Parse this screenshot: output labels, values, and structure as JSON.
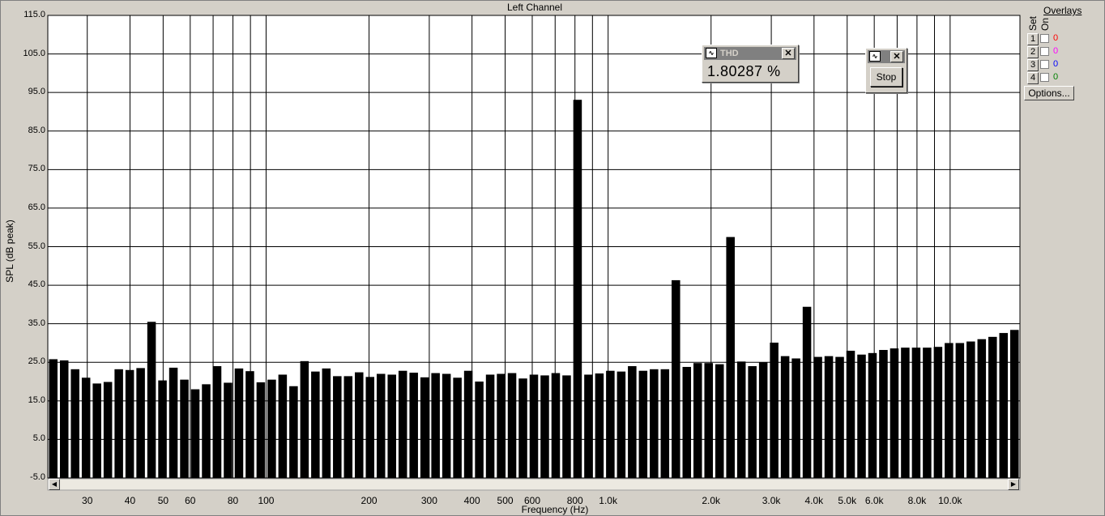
{
  "chart_data": {
    "type": "bar",
    "title": "Left Channel",
    "xlabel": "Frequency (Hz)",
    "ylabel": "SPL (dB peak)",
    "x_scale": "log",
    "xlim": [
      23,
      16000
    ],
    "ylim": [
      -5,
      115
    ],
    "grid": true,
    "y_ticks": [
      "115.0",
      "105.0",
      "95.0",
      "85.0",
      "75.0",
      "65.0",
      "55.0",
      "45.0",
      "35.0",
      "25.0",
      "15.0",
      "5.0",
      "-5.0"
    ],
    "y_tick_values": [
      115,
      105,
      95,
      85,
      75,
      65,
      55,
      45,
      35,
      25,
      15,
      5,
      -5
    ],
    "x_ticks": [
      {
        "value": 30,
        "label": "30"
      },
      {
        "value": 40,
        "label": "40"
      },
      {
        "value": 50,
        "label": "50"
      },
      {
        "value": 60,
        "label": "60"
      },
      {
        "value": 80,
        "label": "80"
      },
      {
        "value": 100,
        "label": "100"
      },
      {
        "value": 200,
        "label": "200"
      },
      {
        "value": 300,
        "label": "300"
      },
      {
        "value": 400,
        "label": "400"
      },
      {
        "value": 500,
        "label": "500"
      },
      {
        "value": 600,
        "label": "600"
      },
      {
        "value": 800,
        "label": "800"
      },
      {
        "value": 1000,
        "label": "1.0k"
      },
      {
        "value": 2000,
        "label": "2.0k"
      },
      {
        "value": 3000,
        "label": "3.0k"
      },
      {
        "value": 4000,
        "label": "4.0k"
      },
      {
        "value": 5000,
        "label": "5.0k"
      },
      {
        "value": 6000,
        "label": "6.0k"
      },
      {
        "value": 8000,
        "label": "8.0k"
      },
      {
        "value": 10000,
        "label": "10.0k"
      }
    ],
    "x_grid_values": [
      30,
      40,
      50,
      60,
      70,
      80,
      90,
      100,
      200,
      300,
      400,
      500,
      600,
      700,
      800,
      900,
      1000,
      2000,
      3000,
      4000,
      5000,
      6000,
      7000,
      8000,
      9000,
      10000
    ],
    "bar_fraction": 0.78,
    "values": [
      25.8,
      25.5,
      23.2,
      21.0,
      19.5,
      19.9,
      23.2,
      23.0,
      23.5,
      35.5,
      20.3,
      23.6,
      20.5,
      18.0,
      19.3,
      24.0,
      19.7,
      23.4,
      22.7,
      19.8,
      20.5,
      21.8,
      18.8,
      25.3,
      22.6,
      23.4,
      21.4,
      21.4,
      22.4,
      21.2,
      22.0,
      21.8,
      22.8,
      22.3,
      21.1,
      22.2,
      22.0,
      21.0,
      22.8,
      20.0,
      21.8,
      22.0,
      22.2,
      20.8,
      21.8,
      21.6,
      22.2,
      21.6,
      93.1,
      21.8,
      22.1,
      22.8,
      22.6,
      24.0,
      22.8,
      23.2,
      23.2,
      46.3,
      23.8,
      24.8,
      24.8,
      24.5,
      57.5,
      25.2,
      24.0,
      25.0,
      30.1,
      26.6,
      26.0,
      39.4,
      26.4,
      26.6,
      26.4,
      28.0,
      27.0,
      27.4,
      28.2,
      28.6,
      28.8,
      28.8,
      28.8,
      29.0,
      30.0,
      30.0,
      30.4,
      31.0,
      31.6,
      32.6,
      33.4
    ]
  },
  "scrollbar": {
    "left_arrow": "◀",
    "right_arrow": "▶"
  },
  "thd_window": {
    "title": "THD",
    "value": "1.80287 %",
    "close": "✕"
  },
  "stop_window": {
    "button": "Stop",
    "close": "✕"
  },
  "overlays": {
    "title": "Overlays",
    "col_set": "Set",
    "col_on": "On",
    "rows": [
      {
        "num": "1",
        "value": "0",
        "color": "#ff0000"
      },
      {
        "num": "2",
        "value": "0",
        "color": "#ff00ff"
      },
      {
        "num": "3",
        "value": "0",
        "color": "#0000ff"
      },
      {
        "num": "4",
        "value": "0",
        "color": "#008000"
      }
    ],
    "options_button": "Options..."
  }
}
